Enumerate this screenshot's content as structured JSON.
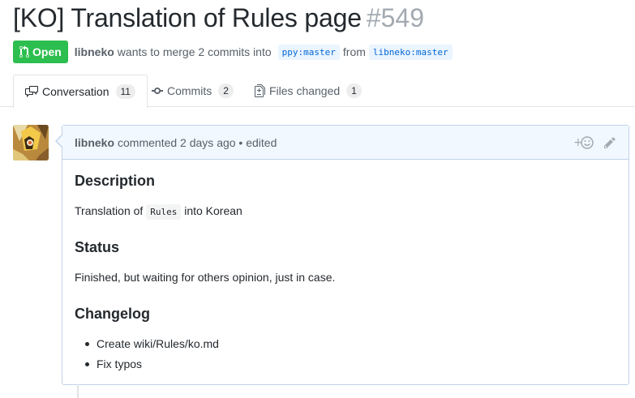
{
  "pr": {
    "title": "[KO] Translation of Rules page",
    "number": "#549",
    "state": "Open",
    "author": "libneko",
    "merge_text": "wants to merge 2 commits into",
    "base_branch": "ppy:master",
    "from_text": "from",
    "head_branch": "libneko:master"
  },
  "tabs": [
    {
      "label": "Conversation",
      "count": "11",
      "icon": "comment-discussion-icon"
    },
    {
      "label": "Commits",
      "count": "2",
      "icon": "git-commit-icon"
    },
    {
      "label": "Files changed",
      "count": "1",
      "icon": "file-diff-icon"
    }
  ],
  "comment": {
    "author": "libneko",
    "meta": "commented 2 days ago • edited",
    "sections": {
      "description_heading": "Description",
      "description_prefix": "Translation of",
      "description_code": "Rules",
      "description_suffix": "into Korean",
      "status_heading": "Status",
      "status_text": "Finished, but waiting for others opinion, just in case.",
      "changelog_heading": "Changelog",
      "changelog_items": [
        "Create wiki/Rules/ko.md",
        "Fix typos"
      ]
    }
  },
  "colors": {
    "open_green": "#2cbe4e",
    "link_blue": "#0366d6",
    "comment_header_bg": "#f1f8ff"
  }
}
